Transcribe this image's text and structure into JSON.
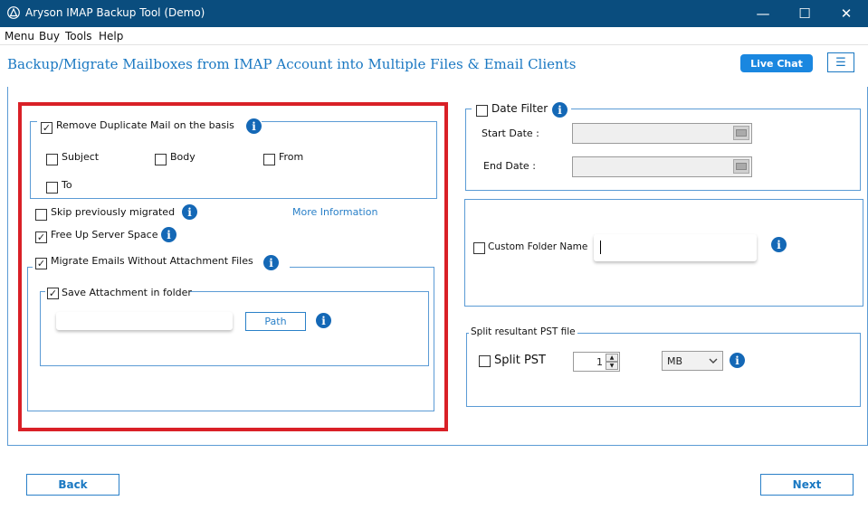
{
  "window": {
    "title": "Aryson IMAP Backup Tool (Demo)",
    "minimize": "—",
    "maximize": "☐",
    "close": "✕"
  },
  "menu": [
    "Menu",
    "Buy",
    "Tools",
    "Help"
  ],
  "header": {
    "title": "Backup/Migrate Mailboxes from IMAP Account into Multiple Files & Email Clients",
    "live_chat": "Live Chat",
    "hamburger": "☰"
  },
  "left": {
    "remove_duplicate": {
      "label": "Remove Duplicate Mail on the basis",
      "checked": true
    },
    "dup_options": [
      {
        "label": "Subject",
        "checked": false
      },
      {
        "label": "Body",
        "checked": false
      },
      {
        "label": "From",
        "checked": false
      },
      {
        "label": "To",
        "checked": false
      }
    ],
    "skip_previously": {
      "label": "Skip previously migrated",
      "checked": false
    },
    "more_info": "More Information",
    "free_up": {
      "label": "Free Up Server Space",
      "checked": true
    },
    "migrate_without_attach": {
      "label": "Migrate Emails Without Attachment Files",
      "checked": true
    },
    "save_attachment": {
      "label": "Save Attachment in folder",
      "checked": true
    },
    "path_button": "Path"
  },
  "right": {
    "date_filter": {
      "label": "Date Filter",
      "checked": false
    },
    "start_date_label": "Start Date :",
    "end_date_label": "End Date :",
    "custom_folder": {
      "label": "Custom Folder Name",
      "checked": false
    },
    "split_group_label": "Split resultant PST file",
    "split_pst": {
      "label": "Split PST",
      "checked": false
    },
    "split_value": "1",
    "split_unit": "MB"
  },
  "footer": {
    "back": "Back",
    "next": "Next"
  },
  "checkmark": "✓",
  "info_glyph": "i",
  "colors": {
    "titlebar": "#0a4d7e",
    "accent": "#1a78c2",
    "highlight": "#d92027"
  }
}
